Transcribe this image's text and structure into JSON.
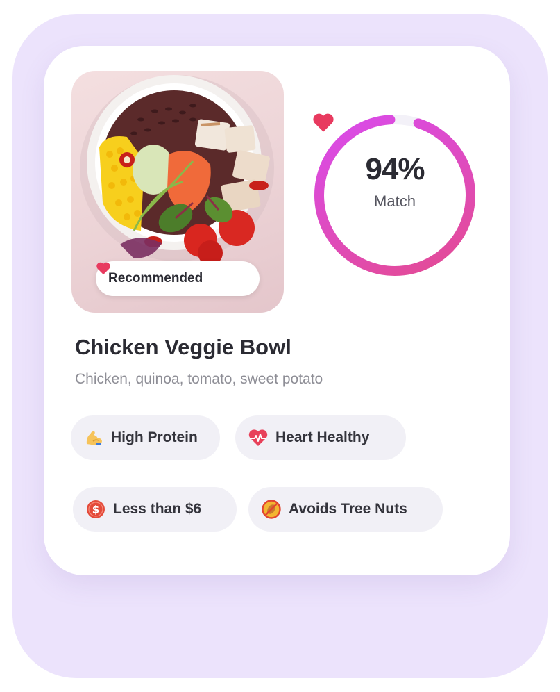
{
  "meal": {
    "badge_label": "Recommended",
    "name": "Chicken Veggie Bowl",
    "ingredients": "Chicken, quinoa, tomato, sweet potato"
  },
  "match": {
    "value_text": "94%",
    "label": "Match",
    "percent": 94
  },
  "tags": [
    {
      "label": "High Protein",
      "icon": "flexed-biceps-icon"
    },
    {
      "label": "Heart Healthy",
      "icon": "heart-pulse-icon"
    },
    {
      "label": "Less than $6",
      "icon": "dollar-coin-icon"
    },
    {
      "label": "Avoids Tree Nuts",
      "icon": "no-nuts-icon"
    }
  ],
  "colors": {
    "background": "#ece3fc",
    "ring_start": "#e44b8f",
    "ring_end": "#d94bef",
    "heart": "#e83a5f",
    "tag_background": "#f1f0f6"
  }
}
